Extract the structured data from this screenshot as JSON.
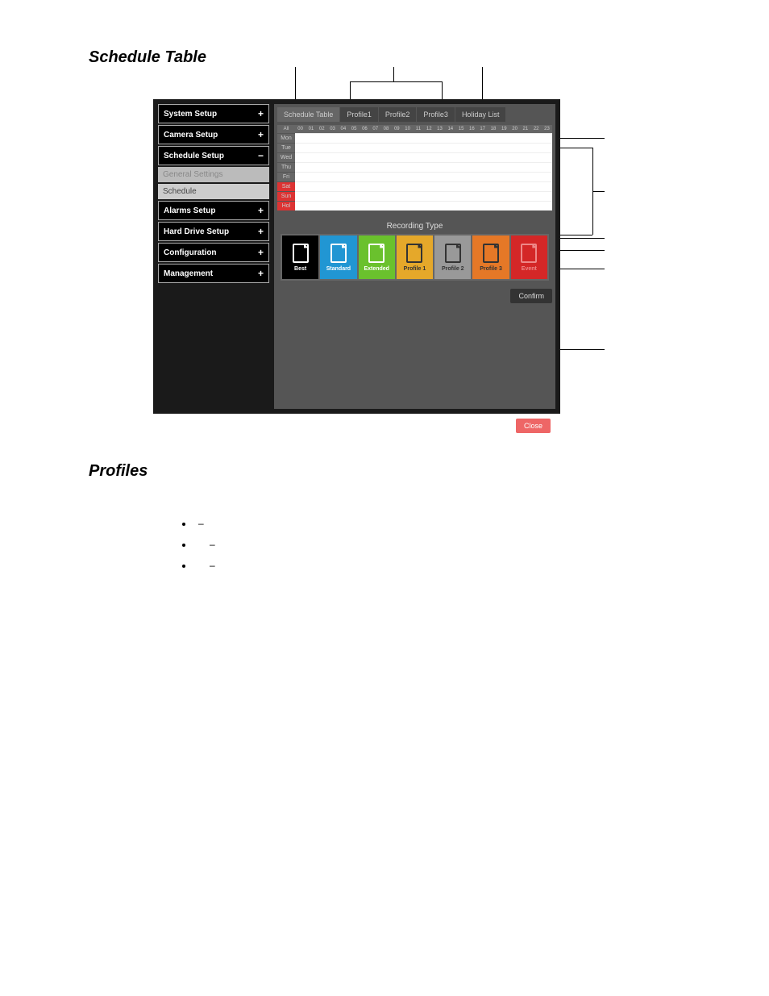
{
  "headings": {
    "schedule_table": "Schedule Table",
    "profiles": "Profiles"
  },
  "sidebar": {
    "system_setup": "System Setup",
    "camera_setup": "Camera Setup",
    "schedule_setup": "Schedule Setup",
    "general_settings": "General Settings",
    "schedule": "Schedule",
    "alarms_setup": "Alarms Setup",
    "hard_drive_setup": "Hard Drive Setup",
    "configuration": "Configuration",
    "management": "Management",
    "plus": "+",
    "minus": "−"
  },
  "tabs": {
    "schedule_table": "Schedule Table",
    "profile1": "Profile1",
    "profile2": "Profile2",
    "profile3": "Profile3",
    "holiday_list": "Holiday List"
  },
  "grid": {
    "all": "All",
    "hours": [
      "00",
      "01",
      "02",
      "03",
      "04",
      "05",
      "06",
      "07",
      "08",
      "09",
      "10",
      "11",
      "12",
      "13",
      "14",
      "15",
      "16",
      "17",
      "18",
      "19",
      "20",
      "21",
      "22",
      "23"
    ],
    "days": [
      "Mon",
      "Tue",
      "Wed",
      "Thu",
      "Fri",
      "Sat",
      "Sun",
      "Hol"
    ],
    "red_days": [
      "Sat",
      "Sun",
      "Hol"
    ]
  },
  "recording": {
    "title": "Recording Type",
    "types": {
      "best": "Best",
      "standard": "Standard",
      "extended": "Extended",
      "profile1": "Profile 1",
      "profile2": "Profile 2",
      "profile3": "Profile 3",
      "event": "Event"
    }
  },
  "buttons": {
    "confirm": "Confirm",
    "close": "Close"
  },
  "bullets": {
    "dash": "–"
  }
}
